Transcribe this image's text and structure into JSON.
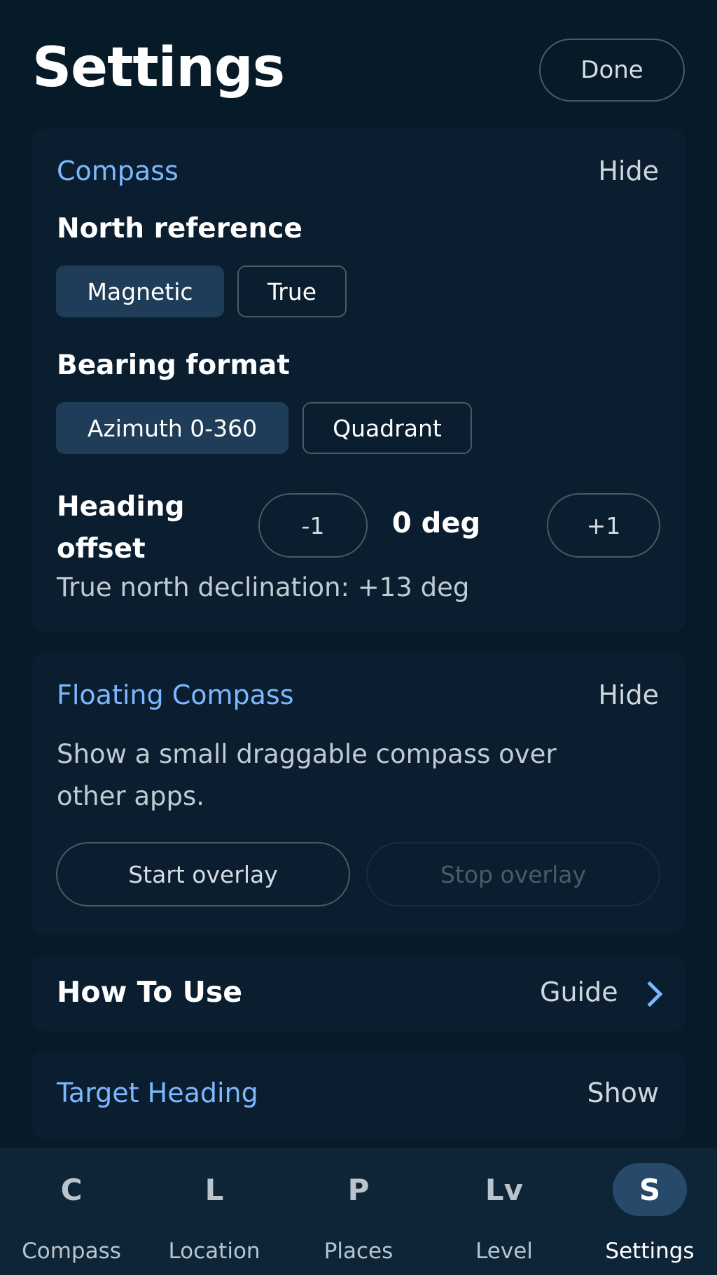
{
  "header": {
    "title": "Settings",
    "done_label": "Done"
  },
  "compass_card": {
    "title": "Compass",
    "toggle_label": "Hide",
    "north_reference": {
      "label": "North reference",
      "options": [
        "Magnetic",
        "True"
      ],
      "selected": "Magnetic"
    },
    "bearing_format": {
      "label": "Bearing format",
      "options": [
        "Azimuth 0-360",
        "Quadrant"
      ],
      "selected": "Azimuth 0-360"
    },
    "heading_offset": {
      "label_line1": "Heading",
      "label_line2": "offset",
      "minus_label": "-1",
      "value": "0 deg",
      "plus_label": "+1"
    },
    "declination_text": "True north declination: +13 deg"
  },
  "floating_card": {
    "title": "Floating Compass",
    "toggle_label": "Hide",
    "description_line1": "Show a small draggable compass over",
    "description_line2": "other apps.",
    "start_label": "Start overlay",
    "stop_label": "Stop overlay"
  },
  "how_to_use": {
    "title": "How To Use",
    "action_label": "Guide"
  },
  "target_heading": {
    "title": "Target Heading",
    "toggle_label": "Show"
  },
  "bottom_nav": {
    "items": [
      {
        "glyph": "C",
        "label": "Compass"
      },
      {
        "glyph": "L",
        "label": "Location"
      },
      {
        "glyph": "P",
        "label": "Places"
      },
      {
        "glyph": "Lv",
        "label": "Level"
      },
      {
        "glyph": "S",
        "label": "Settings"
      }
    ],
    "active": "Settings"
  },
  "colors": {
    "background": "#061a27",
    "card": "#0a1e2f",
    "accent": "#7db7ff",
    "selected_segment": "#1f3d58",
    "nav_background": "#0e2538"
  }
}
